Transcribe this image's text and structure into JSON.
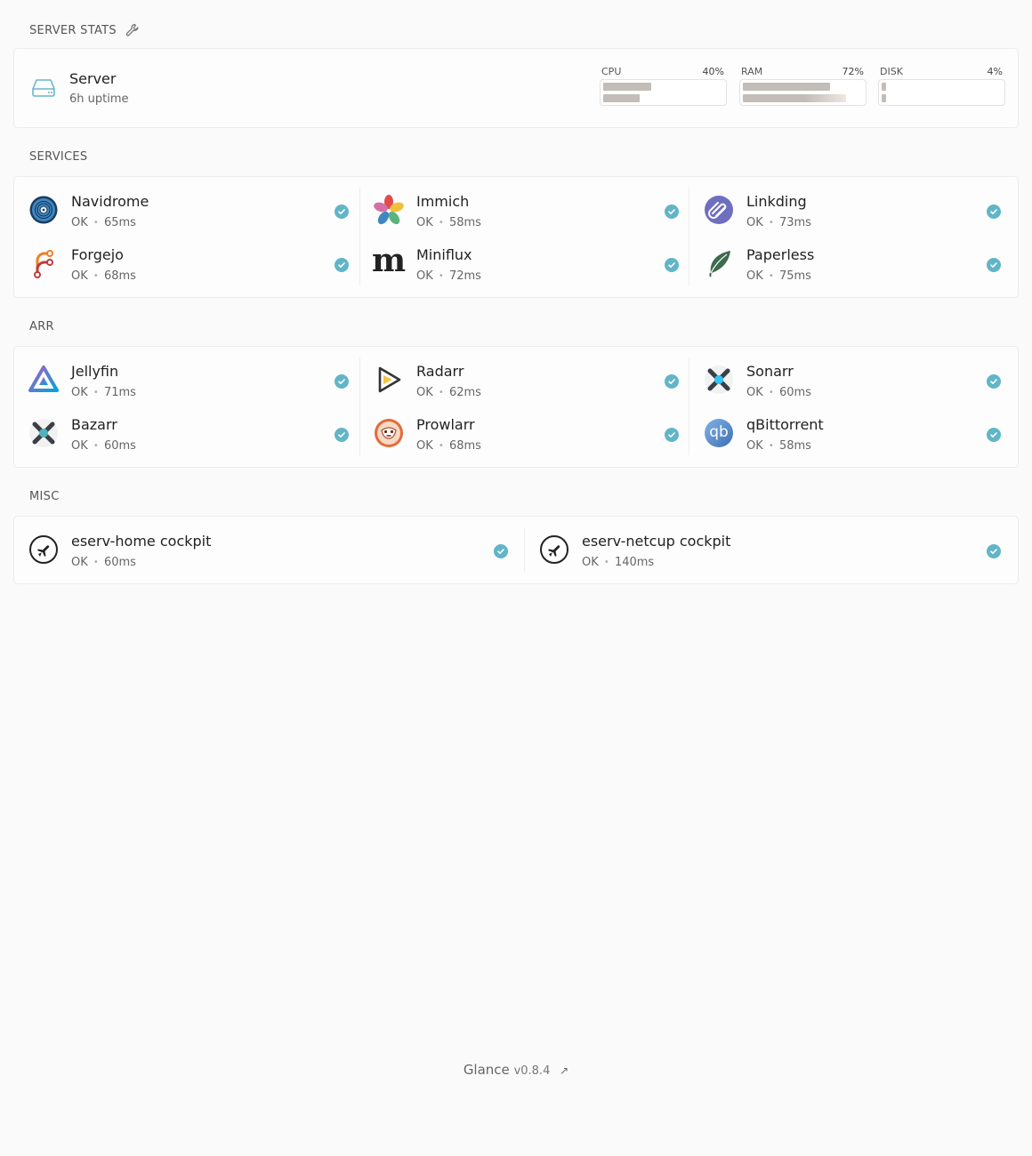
{
  "sections": {
    "server_stats": "SERVER STATS",
    "services": "SERVICES",
    "arr": "ARR",
    "misc": "MISC"
  },
  "server": {
    "name": "Server",
    "uptime": "6h uptime",
    "stats": [
      {
        "label": "CPU",
        "value": "40%",
        "bar1": 0.4,
        "bar2": 0.3
      },
      {
        "label": "RAM",
        "value": "72%",
        "bar1": 0.72,
        "bar2": 0.85
      },
      {
        "label": "DISK",
        "value": "4%",
        "bar1": 0.04,
        "bar2": 0.04
      }
    ]
  },
  "services": [
    {
      "name": "Navidrome",
      "status": "OK",
      "latency": "65ms",
      "icon": "navidrome-icon"
    },
    {
      "name": "Immich",
      "status": "OK",
      "latency": "58ms",
      "icon": "immich-icon"
    },
    {
      "name": "Linkding",
      "status": "OK",
      "latency": "73ms",
      "icon": "linkding-icon"
    },
    {
      "name": "Forgejo",
      "status": "OK",
      "latency": "68ms",
      "icon": "forgejo-icon"
    },
    {
      "name": "Miniflux",
      "status": "OK",
      "latency": "72ms",
      "icon": "miniflux-icon"
    },
    {
      "name": "Paperless",
      "status": "OK",
      "latency": "75ms",
      "icon": "paperless-icon"
    }
  ],
  "arr": [
    {
      "name": "Jellyfin",
      "status": "OK",
      "latency": "71ms",
      "icon": "jellyfin-icon"
    },
    {
      "name": "Radarr",
      "status": "OK",
      "latency": "62ms",
      "icon": "radarr-icon"
    },
    {
      "name": "Sonarr",
      "status": "OK",
      "latency": "60ms",
      "icon": "sonarr-icon"
    },
    {
      "name": "Bazarr",
      "status": "OK",
      "latency": "60ms",
      "icon": "bazarr-icon"
    },
    {
      "name": "Prowlarr",
      "status": "OK",
      "latency": "68ms",
      "icon": "prowlarr-icon"
    },
    {
      "name": "qBittorrent",
      "status": "OK",
      "latency": "58ms",
      "icon": "qbittorrent-icon"
    }
  ],
  "misc": [
    {
      "name": "eserv-home cockpit",
      "status": "OK",
      "latency": "60ms",
      "icon": "cockpit-icon"
    },
    {
      "name": "eserv-netcup cockpit",
      "status": "OK",
      "latency": "140ms",
      "icon": "cockpit-icon"
    }
  ],
  "miniflux_glyph": "m",
  "qbittorrent_glyph": "qb",
  "status_dot": "•",
  "footer": {
    "app": "Glance",
    "version": "v0.8.4",
    "arrow": "↗"
  },
  "colors": {
    "ok": "#62b5c6",
    "bar": "#c2bdb8",
    "background": "#fafafa"
  }
}
